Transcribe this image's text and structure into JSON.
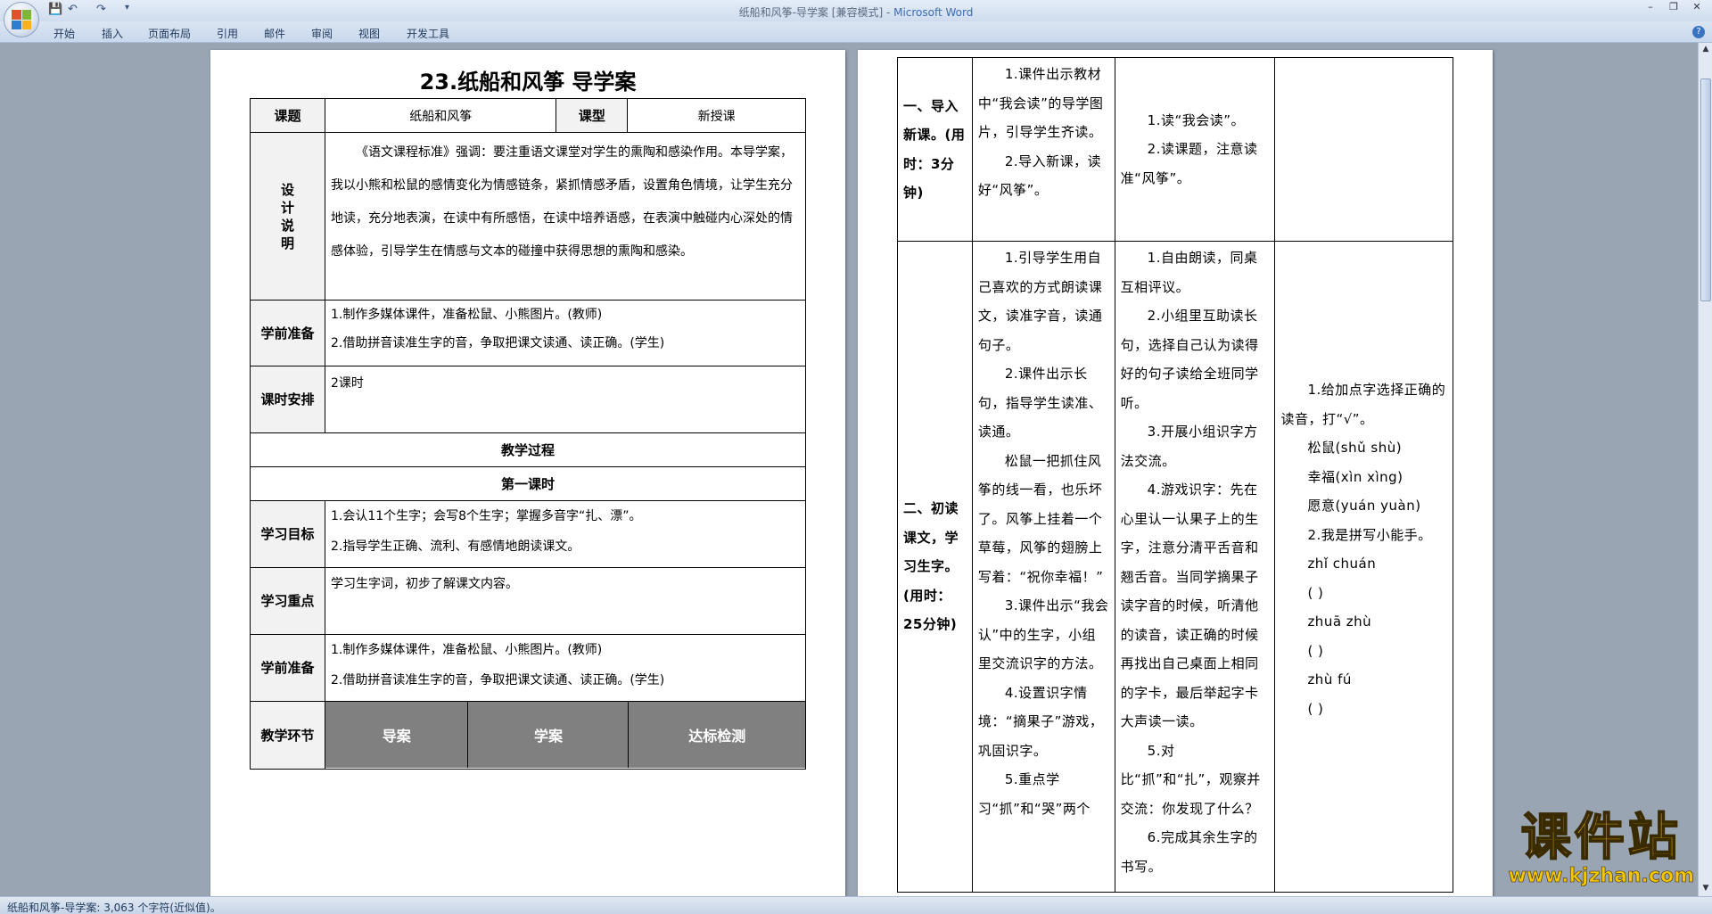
{
  "window": {
    "title": "纸船和风筝-导学案 [兼容模式] - ",
    "app_name": "Microsoft Word"
  },
  "ribbon": {
    "tabs": [
      "开始",
      "插入",
      "页面布局",
      "引用",
      "邮件",
      "审阅",
      "视图",
      "开发工具"
    ]
  },
  "page1": {
    "title": "23.纸船和风筝  导学案",
    "lesson_label": "课题",
    "lesson_value": "纸船和风筝",
    "type_label": "课型",
    "type_value": "新授课",
    "design_label": "设计说明",
    "design_text": "《语文课程标准》强调：要注重语文课堂对学生的熏陶和感染作用。本导学案，我以小熊和松鼠的感情变化为情感链条，紧抓情感矛盾，设置角色情境，让学生充分地读，充分地表演，在读中有所感悟，在读中培养语感，在表演中触碰内心深处的情感体验，引导学生在情感与文本的碰撞中获得思想的熏陶和感染。",
    "prep_label": "学前准备",
    "prep_1": "1.制作多媒体课件，准备松鼠、小熊图片。(教师)",
    "prep_2": "2.借助拼音读准生字的音，争取把课文读通、读正确。(学生)",
    "hours_label": "课时安排",
    "hours_value": "2课时",
    "process_title": "教学过程",
    "first_period": "第一课时",
    "goals_label": "学习目标",
    "goals_1": "1.会认11个生字；会写8个生字；掌握多音字“扎、漂”。",
    "goals_2": "2.指导学生正确、流利、有感情地朗读课文。",
    "focus_label": "学习重点",
    "focus_value": "学习生字词，初步了解课文内容。",
    "prep2_label": "学前准备",
    "prep2_1": "1.制作多媒体课件，准备松鼠、小熊图片。(教师)",
    "prep2_2": "2.借助拼音读准生字的音，争取把课文读通、读正确。(学生)",
    "steps_label": "教学环节",
    "col_guide": "导案",
    "col_study": "学案",
    "col_check": "达标检测"
  },
  "page2": {
    "stage1_label": "一、导入新课。(用时：3分钟)",
    "stage1_guide_1": "1.课件出示教材中“我会读”的导学图片，引导学生齐读。",
    "stage1_guide_2": "2.导入新课，读好“风筝”。",
    "stage1_study_1": "1.读“我会读”。",
    "stage1_study_2": "2.读课题，注意读准“风筝”。",
    "stage2_label": "二、初读课文，学习生字。(用时：25分钟)",
    "stage2_guide_1": "1.引导学生用自己喜欢的方式朗读课文，读准字音，读通句子。",
    "stage2_guide_2": "2.课件出示长句，指导学生读准、读通。",
    "stage2_guide_3": "松鼠一把抓住风筝的线一看，也乐坏了。风筝上挂着一个草莓，风筝的翅膀上写着：“祝你幸福！”",
    "stage2_guide_4": "3.课件出示“我会认”中的生字，小组里交流识字的方法。",
    "stage2_guide_5": "4.设置识字情境：“摘果子”游戏，巩固识字。",
    "stage2_guide_6": "5.重点学习“抓”和“哭”两个",
    "stage2_study_1": "1.自由朗读，同桌互相评议。",
    "stage2_study_2": "2.小组里互助读长句，选择自己认为读得好的句子读给全班同学听。",
    "stage2_study_3": "3.开展小组识字方法交流。",
    "stage2_study_4": "4.游戏识字：先在心里认一认果子上的生字，注意分清平舌音和翘舌音。当同学摘果子读字音的时候，听清他的读音，读正确的时候再找出自己桌面上相同的字卡，最后举起字卡大声读一读。",
    "stage2_study_5": "5.对比“抓”和“扎”，观察并交流：你发现了什么？",
    "stage2_study_6": "6.完成其余生字的书写。",
    "check_1": "1.给加点字选择正确的读音，打“√”。",
    "check_2": "松鼠(shǔ shù)",
    "check_3": "幸福(xìn xìng)",
    "check_4": "愿意(yuán yuàn)",
    "check_5": "2.我是拼写小能手。",
    "check_6": "zhǐ  chuán",
    "check_7": "zhuā  zhù",
    "check_8": "zhù   fú",
    "blank": "(          )"
  },
  "status": {
    "text": "纸船和风筝-导学案: 3,063 个字符(近似值)。"
  },
  "watermark": {
    "logo": "课件站",
    "url": "www.kjzhan.com"
  }
}
